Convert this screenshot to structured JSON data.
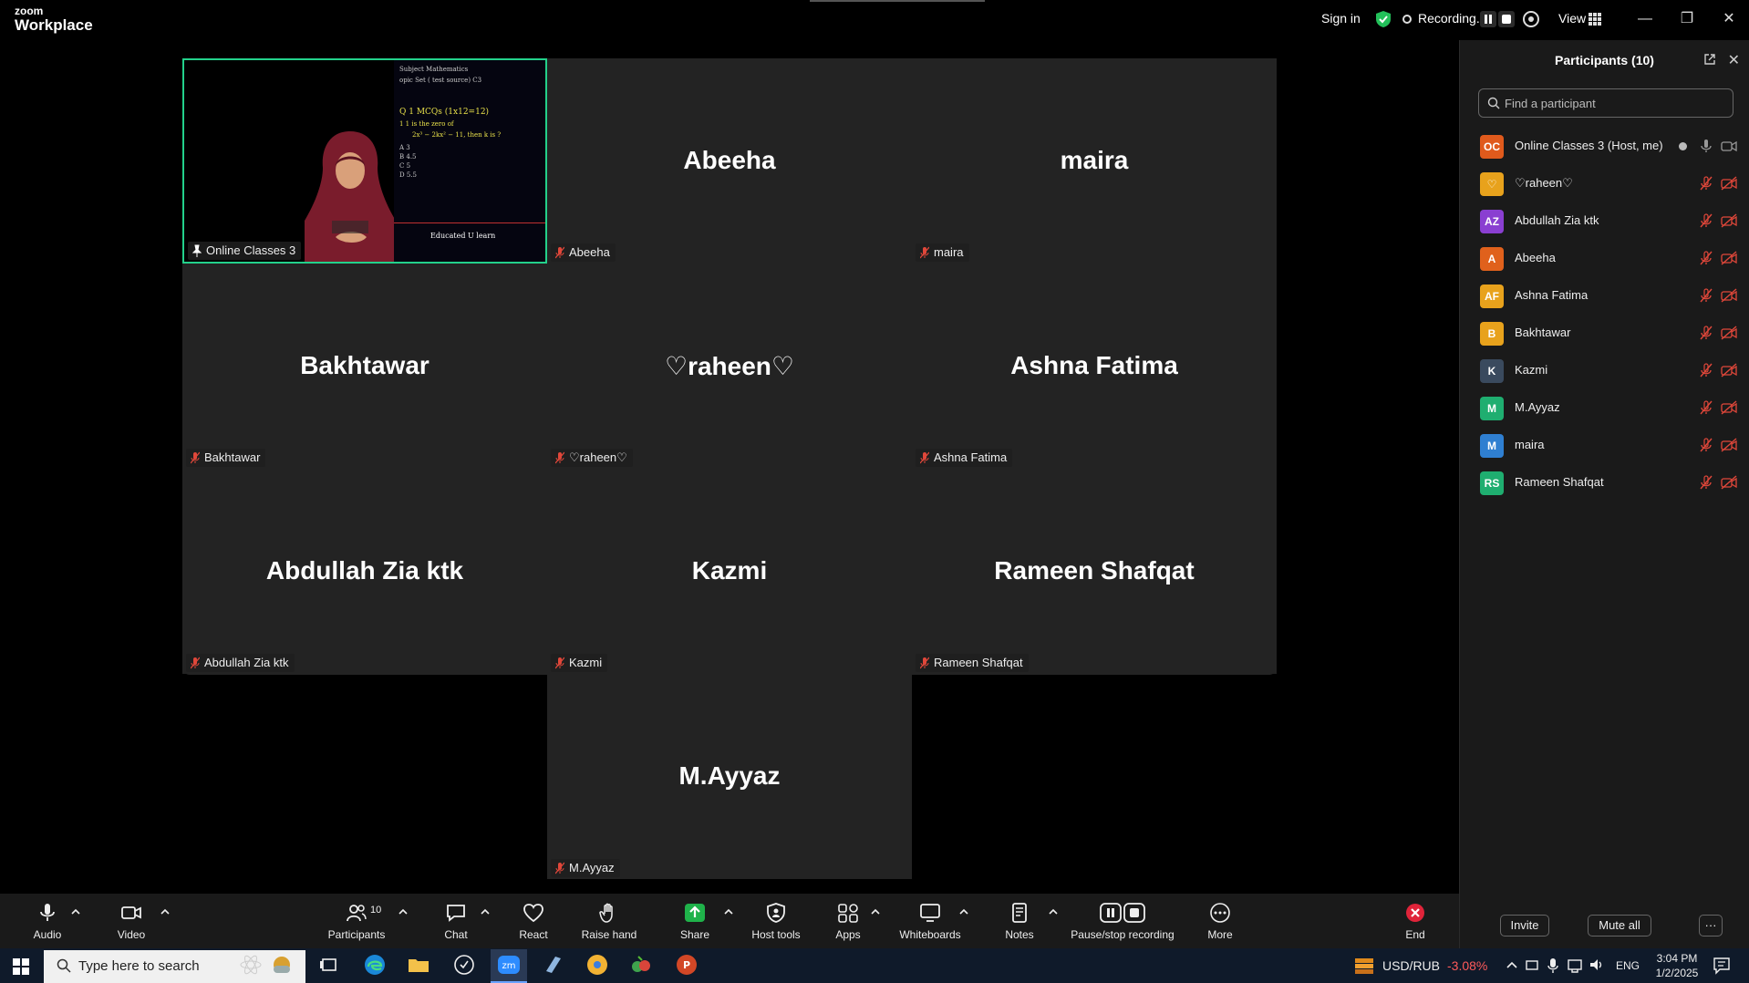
{
  "app": {
    "brand_top": "zoom",
    "brand_bottom": "Workplace"
  },
  "topbar": {
    "sign_in": "Sign in",
    "recording": "Recording...",
    "view": "View"
  },
  "tiles": [
    {
      "big": "",
      "label": "Online Classes 3",
      "active": true
    },
    {
      "big": "Abeeha",
      "label": "Abeeha"
    },
    {
      "big": "maira",
      "label": "maira"
    },
    {
      "big": "Bakhtawar",
      "label": "Bakhtawar"
    },
    {
      "big": "♡raheen♡",
      "label": "♡raheen♡"
    },
    {
      "big": "Ashna Fatima",
      "label": "Ashna Fatima"
    },
    {
      "big": "Abdullah Zia ktk",
      "label": "Abdullah Zia ktk"
    },
    {
      "big": "Kazmi",
      "label": "Kazmi"
    },
    {
      "big": "Rameen Shafqat",
      "label": "Rameen Shafqat"
    },
    {
      "big": "M.Ayyaz",
      "label": "M.Ayyaz"
    }
  ],
  "board": {
    "l1": "Subject   Mathematics",
    "l2": "opic      Set ( test source) C3",
    "l3": "Q 1    MCQs           (1x12=12)",
    "l4": "1   1 is the zero of",
    "l5": "2x³ − 2kx² − 11, then k is ?",
    "l6": "A   3",
    "l7": "B   4.5",
    "l8": "C   5",
    "l9": "D   5.5",
    "l10": "Educated  U learn"
  },
  "panel": {
    "title": "Participants (10)",
    "search_placeholder": "Find a participant",
    "participants": [
      {
        "initials": "OC",
        "name": "Online Classes 3 (Host, me)",
        "color": "#e05a1c",
        "host": true
      },
      {
        "initials": "♡",
        "name": "♡raheen♡",
        "color": "#e8a21c"
      },
      {
        "initials": "AZ",
        "name": "Abdullah Zia ktk",
        "color": "#8a3fd1"
      },
      {
        "initials": "A",
        "name": "Abeeha",
        "color": "#e0611c"
      },
      {
        "initials": "AF",
        "name": "Ashna Fatima",
        "color": "#e8a21c"
      },
      {
        "initials": "B",
        "name": "Bakhtawar",
        "color": "#e8a21c"
      },
      {
        "initials": "K",
        "name": "Kazmi",
        "color": "#3a4a5e"
      },
      {
        "initials": "M",
        "name": "M.Ayyaz",
        "color": "#1fae70"
      },
      {
        "initials": "M",
        "name": "maira",
        "color": "#2f7fd1"
      },
      {
        "initials": "RS",
        "name": "Rameen Shafqat",
        "color": "#1fae70"
      }
    ],
    "invite": "Invite",
    "mute_all": "Mute all",
    "more": "···"
  },
  "toolbar": {
    "audio": "Audio",
    "video": "Video",
    "participants": "Participants",
    "participants_count": "10",
    "chat": "Chat",
    "react": "React",
    "raise_hand": "Raise hand",
    "share": "Share",
    "host_tools": "Host tools",
    "apps": "Apps",
    "whiteboards": "Whiteboards",
    "notes": "Notes",
    "pause_stop": "Pause/stop recording",
    "more": "More",
    "end": "End"
  },
  "taskbar": {
    "search": "Type here to search",
    "currency": "USD/RUB",
    "change": "-3.08%",
    "lang": "ENG",
    "time": "3:04 PM",
    "date": "1/2/2025"
  },
  "colors": {
    "active_border": "#23d18b",
    "muted": "#e0473a",
    "share": "#1fb24a",
    "end": "#e0243a"
  }
}
